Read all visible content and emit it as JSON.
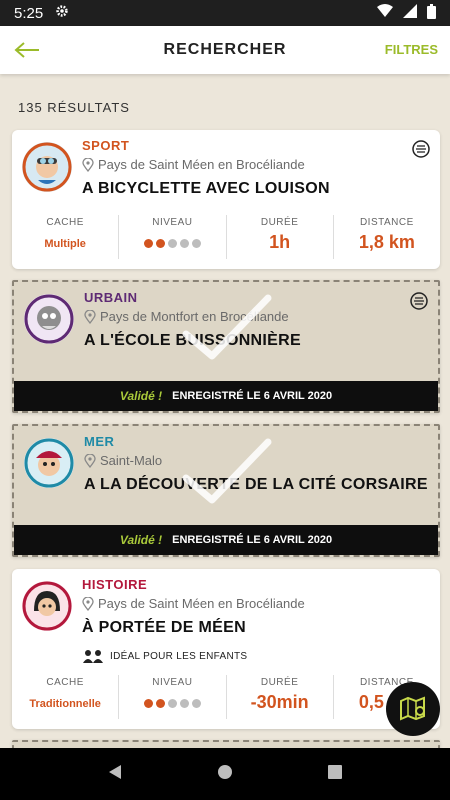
{
  "status": {
    "time": "5:25"
  },
  "appbar": {
    "title": "RECHERCHER",
    "filters_label": "FILTRES"
  },
  "results": {
    "count_label": "135 RÉSULTATS"
  },
  "stat_labels": {
    "cache": "CACHE",
    "level": "NIVEAU",
    "duration": "DURÉE",
    "distance": "DISTANCE"
  },
  "cards": [
    {
      "category": "SPORT",
      "category_color": "#d2541f",
      "location": "Pays de Saint Méen en Brocéliande",
      "title": "A BICYCLETTE AVEC LOUISON",
      "cache": "Multiple",
      "level": 2,
      "duration": "1h",
      "distance": "1,8 km"
    },
    {
      "category": "URBAIN",
      "category_color": "#5e2a74",
      "location": "Pays de Montfort en Brocéliande",
      "title": "A L'ÉCOLE BUISSONNIÈRE",
      "validated_label": "Validé !",
      "saved_label": "ENREGISTRÉ LE 6 AVRIL 2020"
    },
    {
      "category": "MER",
      "category_color": "#1f8aa6",
      "location": "Saint-Malo",
      "title": "A LA DÉCOUVERTE DE LA CITÉ CORSAIRE",
      "validated_label": "Validé !",
      "saved_label": "ENREGISTRÉ LE 6 AVRIL 2020"
    },
    {
      "category": "HISTOIRE",
      "category_color": "#b3183c",
      "location": "Pays de Saint Méen en Brocéliande",
      "title": "À PORTÉE DE MÉEN",
      "kids_label": "IDÉAL POUR LES ENFANTS",
      "cache": "Traditionnelle",
      "level": 2,
      "duration": "-30min",
      "distance": "0,5 km"
    }
  ],
  "colors": {
    "accent": "#9bbb2a",
    "orange": "#d2541f",
    "background": "#ece6da"
  }
}
